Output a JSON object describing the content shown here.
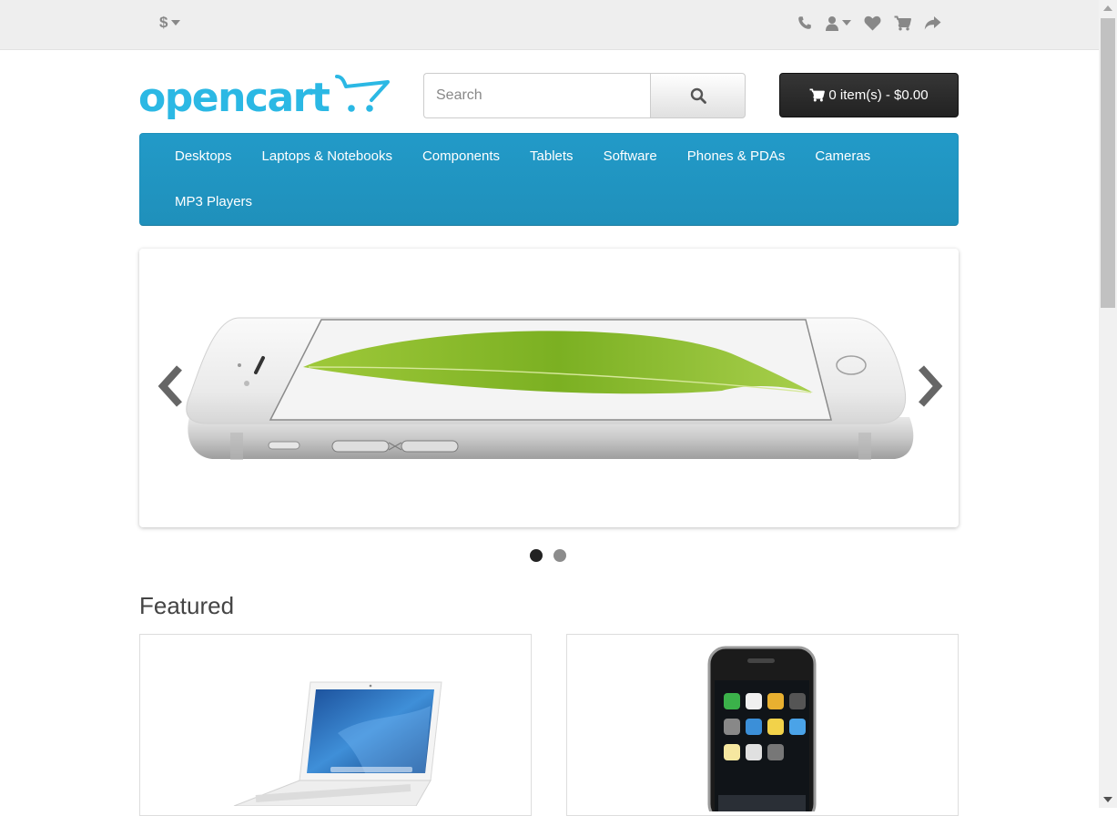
{
  "topbar": {
    "currency_symbol": "$",
    "icons": [
      "phone-icon",
      "user-icon",
      "heart-icon",
      "cart-icon",
      "share-icon"
    ]
  },
  "header": {
    "logo_text": "opencart",
    "search_placeholder": "Search",
    "cart_label": "0 item(s) - $0.00"
  },
  "menu": {
    "items": [
      "Desktops",
      "Laptops & Notebooks",
      "Components",
      "Tablets",
      "Software",
      "Phones & PDAs",
      "Cameras",
      "MP3 Players"
    ]
  },
  "slideshow": {
    "slide_count": 2,
    "active_index": 0
  },
  "featured": {
    "title": "Featured"
  },
  "colors": {
    "menu_blue": "#229ac8",
    "logo_blue": "#2bb8e4",
    "cart_button": "#2a2a2a",
    "topbar_bg": "#eeeeee"
  }
}
